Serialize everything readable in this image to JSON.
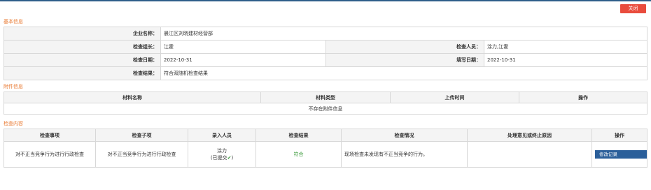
{
  "header": {
    "close_label": "关闭"
  },
  "basic": {
    "section_title": "基本信息",
    "company_label": "企业名称：",
    "company_value": "晨江区刘晓建材经营部",
    "leader_label": "检查组长：",
    "leader_value": "江霍",
    "inspector_label": "检查人员：",
    "inspector_value": "涂力,江霍",
    "date_label": "检查日期：",
    "date_value": "2022-10-31",
    "fill_date_label": "填写日期：",
    "fill_date_value": "2022-10-31",
    "result_label": "检查结果：",
    "result_value": "符合双随机检查结果"
  },
  "attachments": {
    "section_title": "附件信息",
    "columns": [
      "材料名称",
      "材料类型",
      "上传时间",
      "操作"
    ],
    "empty_text": "不存在附件信息"
  },
  "inspection": {
    "section_title": "检查内容",
    "columns": [
      "检查事项",
      "检查子项",
      "录入人员",
      "检查结果",
      "检查情况",
      "处理意见或终止原因",
      "操作"
    ],
    "rows": [
      {
        "item": "对不正当竞争行为进行行政检查",
        "subitem": "对不正当竞争行为进行行政检查",
        "entered_by": "涂力",
        "submitted": "(已提交",
        "submitted_end": ")",
        "result": "符合",
        "situation": "现场检查未发现有不正当竞争的行为。",
        "opinion": "",
        "action": "修改记录"
      }
    ]
  },
  "colors": {
    "accent": "#e8772e",
    "close": "#e94c3d",
    "edit": "#2b5f9a",
    "ok": "#3a9a3a"
  }
}
